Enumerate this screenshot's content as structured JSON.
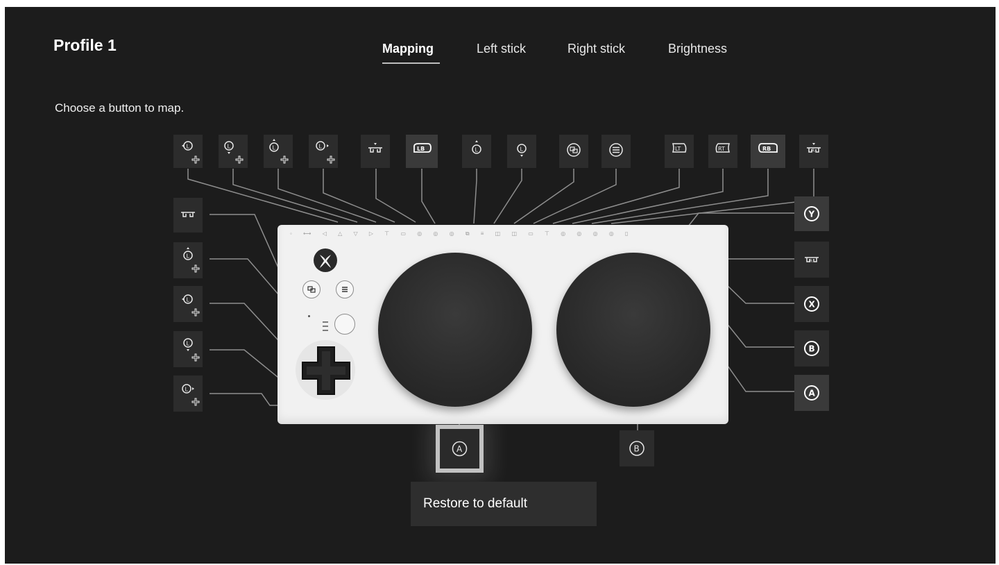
{
  "header": {
    "profile_title": "Profile 1",
    "tabs": [
      {
        "label": "Mapping",
        "active": true
      },
      {
        "label": "Left stick",
        "active": false
      },
      {
        "label": "Right stick",
        "active": false
      },
      {
        "label": "Brightness",
        "active": false
      }
    ]
  },
  "instruction": "Choose a button to map.",
  "mapping_slots": {
    "top_row": [
      {
        "icon": "left-stick-left-dpad-icon"
      },
      {
        "icon": "left-stick-down-dpad-icon"
      },
      {
        "icon": "left-stick-up-dpad-icon"
      },
      {
        "icon": "left-stick-right-dpad-icon"
      },
      {
        "icon": "left-trigger-press-icon"
      },
      {
        "icon": "lb-bumper-icon",
        "label": "LB"
      },
      {
        "icon": "left-stick-up-icon"
      },
      {
        "icon": "left-stick-down-icon"
      },
      {
        "icon": "view-button-icon"
      },
      {
        "icon": "menu-button-icon"
      },
      {
        "icon": "lt-trigger-icon",
        "label": "LT"
      },
      {
        "icon": "rt-trigger-icon",
        "label": "RT"
      },
      {
        "icon": "rb-bumper-icon",
        "label": "RB"
      },
      {
        "icon": "right-trigger-press-icon"
      }
    ],
    "left_column": [
      {
        "icon": "left-trigger-press-icon"
      },
      {
        "icon": "left-stick-up-dpad-icon"
      },
      {
        "icon": "left-stick-left-dpad-icon"
      },
      {
        "icon": "left-stick-down-dpad-icon"
      },
      {
        "icon": "left-stick-right-dpad-icon"
      }
    ],
    "right_column": [
      {
        "icon": "y-button-icon",
        "label": "Y"
      },
      {
        "icon": "right-trigger-press-icon"
      },
      {
        "icon": "x-button-icon",
        "label": "X"
      },
      {
        "icon": "b-button-icon",
        "label": "B"
      },
      {
        "icon": "a-button-icon",
        "label": "A"
      }
    ],
    "big_button_left": {
      "icon": "a-button-icon",
      "label": "A",
      "selected": true
    },
    "big_button_right": {
      "icon": "b-button-icon",
      "label": "B"
    }
  },
  "footer": {
    "restore_label": "Restore to default"
  }
}
